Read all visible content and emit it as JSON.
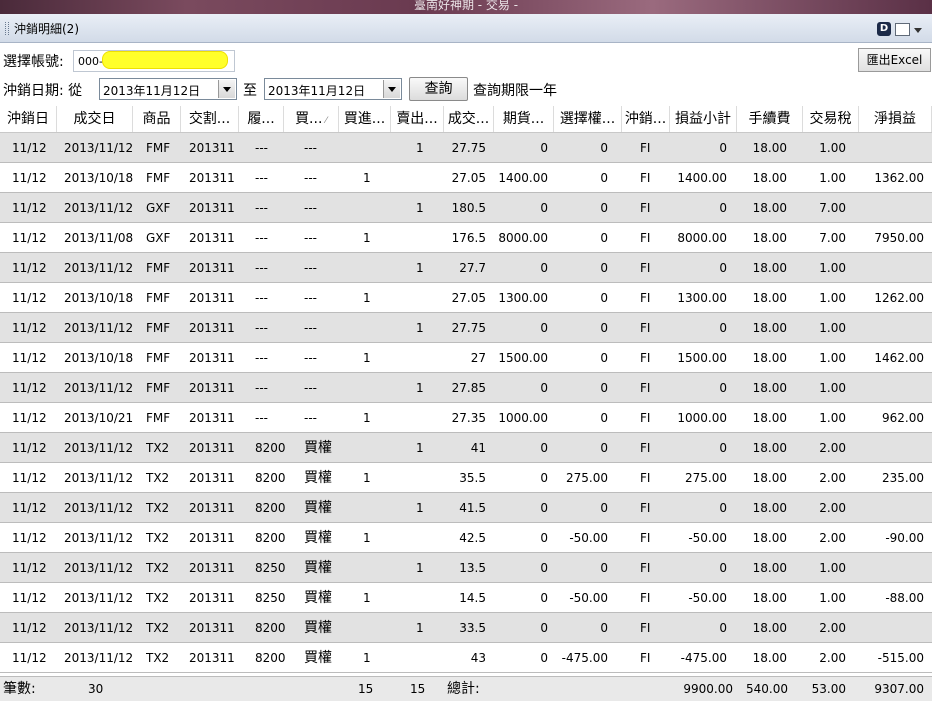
{
  "window_title": "臺南好神期 - 交易 -",
  "panel_title": "沖銷明細(2)",
  "account": {
    "label": "選擇帳號:",
    "value": "000-"
  },
  "export_label": "匯出Excel",
  "date_filter": {
    "label": "沖銷日期: 從",
    "from": "2013年11月12日",
    "to_label": "至",
    "to": "2013年11月12日",
    "query_label": "查詢",
    "limit_note": "查詢期限一年"
  },
  "columns": [
    "沖銷日",
    "成交日",
    "商品",
    "交割...",
    "履...",
    "買...",
    "買進...",
    "賣出...",
    "成交...",
    "期貨...",
    "選擇權...",
    "沖銷...",
    "損益小計",
    "手續費",
    "交易稅",
    "淨損益"
  ],
  "rows": [
    [
      "11/12",
      "2013/11/12",
      "FMF",
      "201311",
      "---",
      "---",
      "",
      "1",
      "27.75",
      "0",
      "0",
      "FI",
      "0",
      "18.00",
      "1.00",
      ""
    ],
    [
      "11/12",
      "2013/10/18",
      "FMF",
      "201311",
      "---",
      "---",
      "1",
      "",
      "27.05",
      "1400.00",
      "0",
      "FI",
      "1400.00",
      "18.00",
      "1.00",
      "1362.00"
    ],
    [
      "11/12",
      "2013/11/12",
      "GXF",
      "201311",
      "---",
      "---",
      "",
      "1",
      "180.5",
      "0",
      "0",
      "FI",
      "0",
      "18.00",
      "7.00",
      ""
    ],
    [
      "11/12",
      "2013/11/08",
      "GXF",
      "201311",
      "---",
      "---",
      "1",
      "",
      "176.5",
      "8000.00",
      "0",
      "FI",
      "8000.00",
      "18.00",
      "7.00",
      "7950.00"
    ],
    [
      "11/12",
      "2013/11/12",
      "FMF",
      "201311",
      "---",
      "---",
      "",
      "1",
      "27.7",
      "0",
      "0",
      "FI",
      "0",
      "18.00",
      "1.00",
      ""
    ],
    [
      "11/12",
      "2013/10/18",
      "FMF",
      "201311",
      "---",
      "---",
      "1",
      "",
      "27.05",
      "1300.00",
      "0",
      "FI",
      "1300.00",
      "18.00",
      "1.00",
      "1262.00"
    ],
    [
      "11/12",
      "2013/11/12",
      "FMF",
      "201311",
      "---",
      "---",
      "",
      "1",
      "27.75",
      "0",
      "0",
      "FI",
      "0",
      "18.00",
      "1.00",
      ""
    ],
    [
      "11/12",
      "2013/10/18",
      "FMF",
      "201311",
      "---",
      "---",
      "1",
      "",
      "27",
      "1500.00",
      "0",
      "FI",
      "1500.00",
      "18.00",
      "1.00",
      "1462.00"
    ],
    [
      "11/12",
      "2013/11/12",
      "FMF",
      "201311",
      "---",
      "---",
      "",
      "1",
      "27.85",
      "0",
      "0",
      "FI",
      "0",
      "18.00",
      "1.00",
      ""
    ],
    [
      "11/12",
      "2013/10/21",
      "FMF",
      "201311",
      "---",
      "---",
      "1",
      "",
      "27.35",
      "1000.00",
      "0",
      "FI",
      "1000.00",
      "18.00",
      "1.00",
      "962.00"
    ],
    [
      "11/12",
      "2013/11/12",
      "TX2",
      "201311",
      "8200",
      "買權",
      "",
      "1",
      "41",
      "0",
      "0",
      "FI",
      "0",
      "18.00",
      "2.00",
      ""
    ],
    [
      "11/12",
      "2013/11/12",
      "TX2",
      "201311",
      "8200",
      "買權",
      "1",
      "",
      "35.5",
      "0",
      "275.00",
      "FI",
      "275.00",
      "18.00",
      "2.00",
      "235.00"
    ],
    [
      "11/12",
      "2013/11/12",
      "TX2",
      "201311",
      "8200",
      "買權",
      "",
      "1",
      "41.5",
      "0",
      "0",
      "FI",
      "0",
      "18.00",
      "2.00",
      ""
    ],
    [
      "11/12",
      "2013/11/12",
      "TX2",
      "201311",
      "8200",
      "買權",
      "1",
      "",
      "42.5",
      "0",
      "-50.00",
      "FI",
      "-50.00",
      "18.00",
      "2.00",
      "-90.00"
    ],
    [
      "11/12",
      "2013/11/12",
      "TX2",
      "201311",
      "8250",
      "買權",
      "",
      "1",
      "13.5",
      "0",
      "0",
      "FI",
      "0",
      "18.00",
      "1.00",
      ""
    ],
    [
      "11/12",
      "2013/11/12",
      "TX2",
      "201311",
      "8250",
      "買權",
      "1",
      "",
      "14.5",
      "0",
      "-50.00",
      "FI",
      "-50.00",
      "18.00",
      "1.00",
      "-88.00"
    ],
    [
      "11/12",
      "2013/11/12",
      "TX2",
      "201311",
      "8200",
      "買權",
      "",
      "1",
      "33.5",
      "0",
      "0",
      "FI",
      "0",
      "18.00",
      "2.00",
      ""
    ],
    [
      "11/12",
      "2013/11/12",
      "TX2",
      "201311",
      "8200",
      "買權",
      "1",
      "",
      "43",
      "0",
      "-475.00",
      "FI",
      "-475.00",
      "18.00",
      "2.00",
      "-515.00"
    ]
  ],
  "footer": {
    "count_label": "筆數:",
    "count": "30",
    "buy_total": "15",
    "sell_total": "15",
    "total_label": "總計:",
    "pnl_total": "9900.00",
    "fee_total": "540.00",
    "tax_total": "53.00",
    "net_total": "9307.00"
  }
}
